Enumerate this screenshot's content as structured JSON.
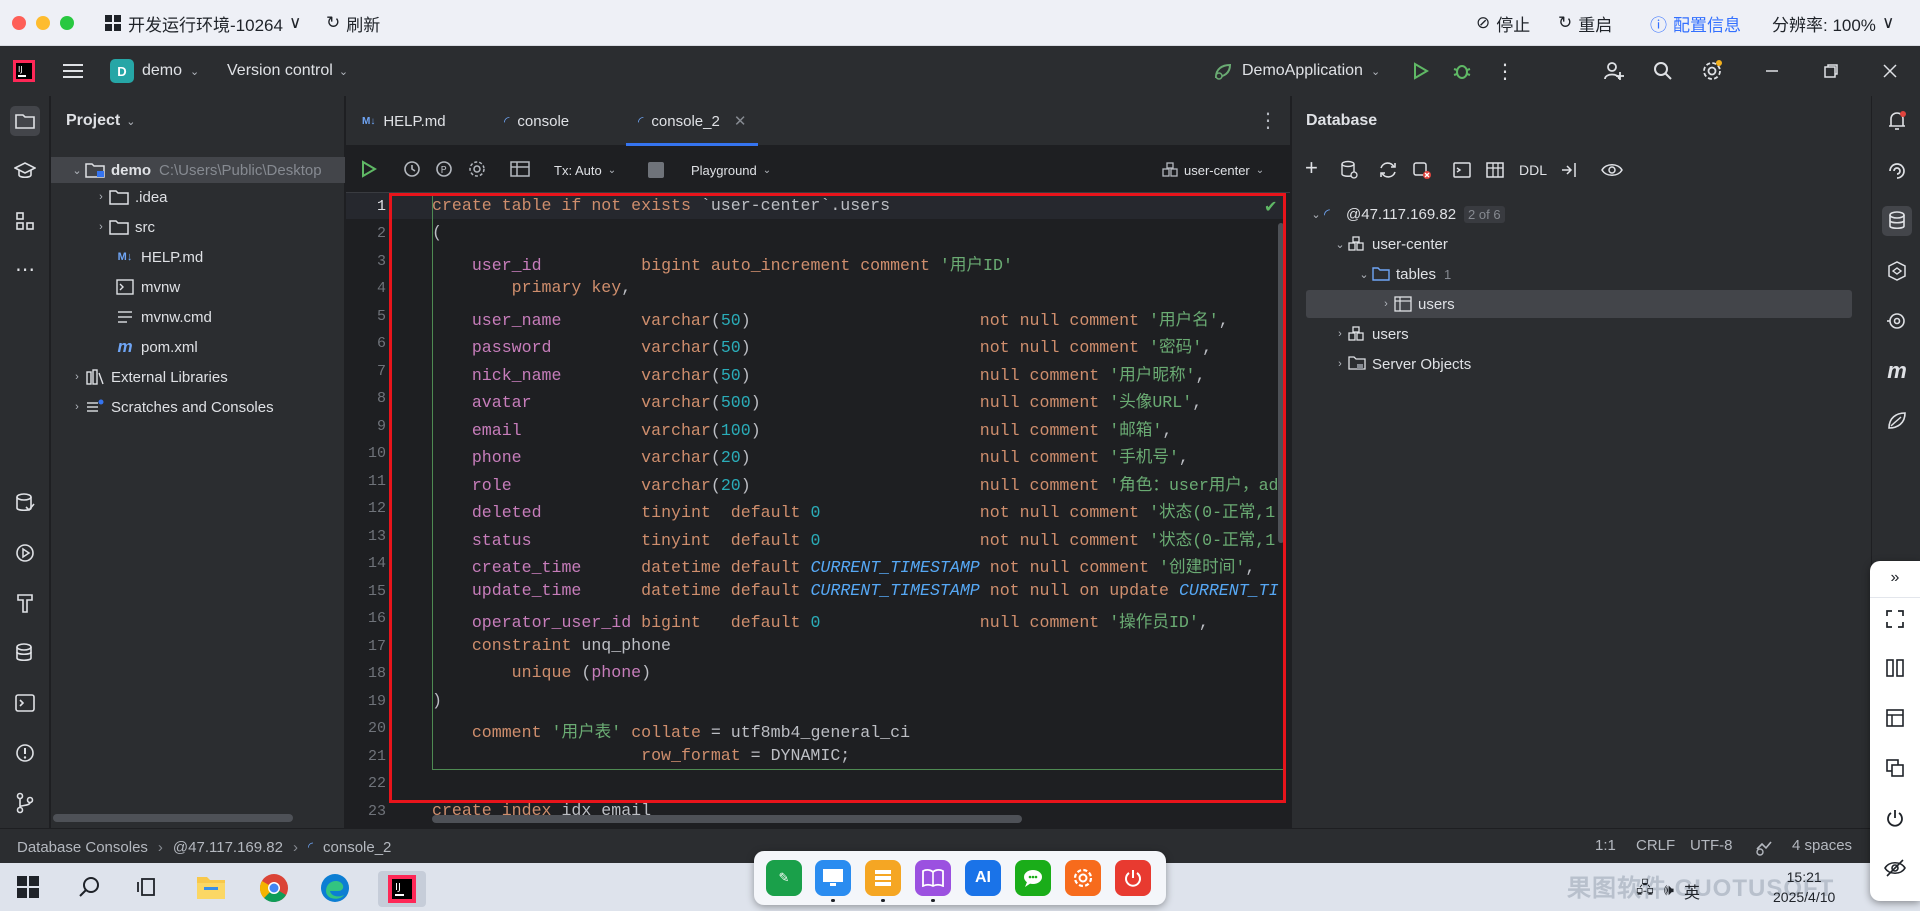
{
  "remote": {
    "env_title": "开发运行环境-10264",
    "refresh": "刷新",
    "stop": "停止",
    "restart": "重启",
    "config": "配置信息",
    "resolution": "分辨率: 100%"
  },
  "ide": {
    "project_badge": "D",
    "project_name": "demo",
    "vcs": "Version control",
    "run_config": "DemoApplication"
  },
  "project_panel": {
    "title": "Project",
    "root_name": "demo",
    "root_path": "C:\\Users\\Public\\Desktop",
    "items": [
      {
        "label": ".idea"
      },
      {
        "label": "src"
      },
      {
        "label": "HELP.md"
      },
      {
        "label": "mvnw"
      },
      {
        "label": "mvnw.cmd"
      },
      {
        "label": "pom.xml"
      },
      {
        "label": "External Libraries"
      },
      {
        "label": "Scratches and Consoles"
      }
    ]
  },
  "tabs": [
    {
      "label": "HELP.md"
    },
    {
      "label": "console"
    },
    {
      "label": "console_2"
    }
  ],
  "toolbar": {
    "tx": "Tx: Auto",
    "playground": "Playground",
    "schema": "user-center"
  },
  "code": {
    "line_numbers": [
      "1",
      "2",
      "3",
      "4",
      "5",
      "6",
      "7",
      "8",
      "9",
      "10",
      "11",
      "12",
      "13",
      "14",
      "15",
      "16",
      "17",
      "18",
      "19",
      "20",
      "21",
      "22",
      "23"
    ]
  },
  "database": {
    "title": "Database",
    "ddl": "DDL",
    "host": "@47.117.169.82",
    "host_badge": "2 of 6",
    "schema": "user-center",
    "tables_label": "tables",
    "tables_count": "1",
    "table_users": "users",
    "users_schema": "users",
    "server_objects": "Server Objects"
  },
  "status_bar": {
    "crumb1": "Database Consoles",
    "crumb2": "@47.117.169.82",
    "crumb3": "console_2",
    "position": "1:1",
    "line_sep": "CRLF",
    "encoding": "UTF-8",
    "indent": "4 spaces"
  },
  "taskbar": {
    "time": "15:21",
    "date": "2025/4/10",
    "lang": "英"
  },
  "colors": {
    "highlight": "#e8141b",
    "accent": "#3574f0"
  }
}
